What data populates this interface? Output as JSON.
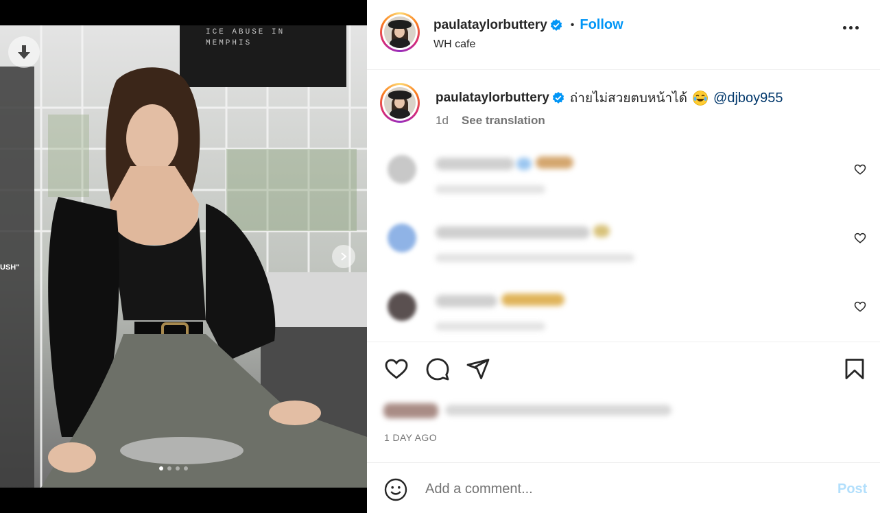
{
  "post": {
    "username": "paulataylorbuttery",
    "separator": "•",
    "follow_label": "Follow",
    "location": "WH cafe"
  },
  "caption": {
    "username": "paulataylorbuttery",
    "text": "ถ่ายไม่สวยตบหน้าได้",
    "emoji": "face-with-tears-of-joy",
    "mention": "@djboy955",
    "age": "1d",
    "see_translation": "See translation"
  },
  "comments": [
    {
      "blurred": true
    },
    {
      "blurred": true
    },
    {
      "blurred": true
    }
  ],
  "footer": {
    "time_ago": "1 DAY AGO",
    "comment_placeholder": "Add a comment...",
    "post_label": "Post"
  },
  "media": {
    "signage_text": [
      "ICE ABUSE IN",
      "MEMPHIS"
    ],
    "side_text": "USH\"",
    "carousel_index": 1,
    "carousel_total": 4
  },
  "colors": {
    "accent": "#0095f6",
    "mention": "#00376b",
    "muted": "#737373",
    "post_disabled": "#b2dffc"
  }
}
